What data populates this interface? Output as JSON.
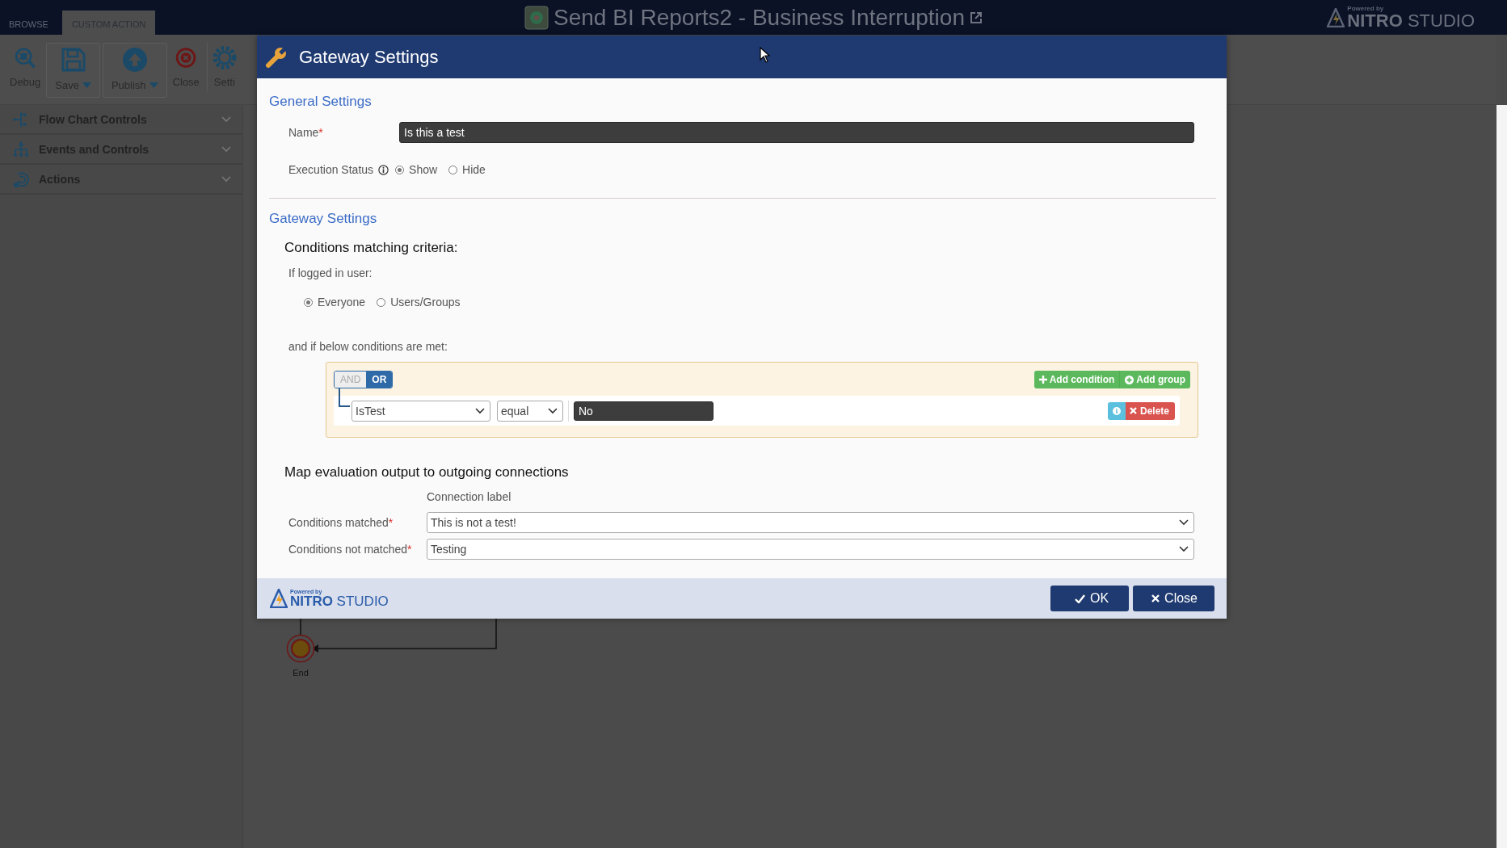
{
  "app_header": {
    "title": "Send BI Reports2 - Business Interruption",
    "logo": {
      "powered_by": "Powered by",
      "brand": "**NITRO** STUDIO"
    }
  },
  "ribbon_tabs": [
    {
      "label": "BROWSE",
      "selected": false
    },
    {
      "label": "CUSTOM ACTION",
      "selected": true
    }
  ],
  "ribbon_buttons": [
    {
      "label": "Debug",
      "kind": "debug",
      "dropdown": false
    },
    {
      "label": "Save",
      "kind": "save",
      "dropdown": true
    },
    {
      "label": "Publish",
      "kind": "publish",
      "dropdown": true
    },
    {
      "label": "Close",
      "kind": "close",
      "dropdown": false
    },
    {
      "label": "Setti",
      "kind": "settings",
      "dropdown": false
    }
  ],
  "sidebar": {
    "items": [
      {
        "label": "Flow Chart Controls",
        "kind": "flow",
        "expanded": false
      },
      {
        "label": "Events and Controls",
        "kind": "events",
        "expanded": false
      },
      {
        "label": "Actions",
        "kind": "actions",
        "expanded": false
      }
    ]
  },
  "canvas": {
    "nodes": [
      {
        "label": "End",
        "kind": "end"
      }
    ]
  },
  "dialog": {
    "title": "Gateway Settings",
    "general": {
      "heading": "General Settings",
      "name": {
        "label": "Name",
        "required_mark": "*",
        "value": "Is this a test"
      },
      "execution_status": {
        "label": "Execution Status",
        "options": [
          {
            "label": "Show",
            "selected": true
          },
          {
            "label": "Hide",
            "selected": false
          }
        ]
      }
    },
    "gateway": {
      "heading": "Gateway Settings",
      "criteria_heading": "Conditions matching criteria:",
      "user_label": "If logged in user:",
      "user_options": [
        {
          "label": "Everyone",
          "selected": true
        },
        {
          "label": "Users/Groups",
          "selected": false
        }
      ],
      "conditions_label": "and if below conditions are met:",
      "builder": {
        "operators": [
          {
            "label": "AND",
            "selected": false
          },
          {
            "label": "OR",
            "selected": true
          }
        ],
        "actions": [
          {
            "label": "Add condition",
            "kind": "add"
          },
          {
            "label": "Add group",
            "kind": "group"
          }
        ],
        "rules": [
          {
            "field": "IsTest",
            "operator": "equal",
            "value": "No",
            "delete": "Delete"
          }
        ]
      },
      "map_heading": "Map evaluation output to outgoing connections",
      "column_label": "Connection label",
      "mappings": [
        {
          "label": "Conditions matched",
          "required_mark": "*",
          "value": "This is not a test!"
        },
        {
          "label": "Conditions not matched",
          "required_mark": "*",
          "value": "Testing"
        }
      ]
    },
    "footer_logo": {
      "powered_by": "Powered by",
      "brand": "**NITRO** STUDIO"
    },
    "buttons": [
      {
        "label": "OK",
        "kind": "ok"
      },
      {
        "label": "Close",
        "kind": "close"
      }
    ]
  }
}
